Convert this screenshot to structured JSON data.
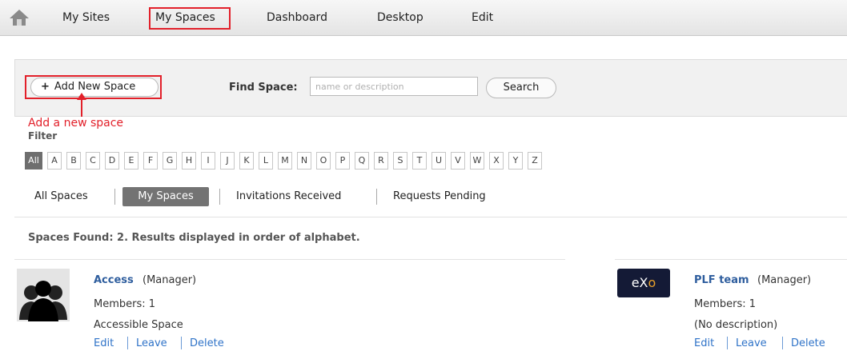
{
  "nav": {
    "items": [
      {
        "label": "My Sites"
      },
      {
        "label": "My Spaces"
      },
      {
        "label": "Dashboard"
      },
      {
        "label": "Desktop"
      },
      {
        "label": "Edit"
      }
    ]
  },
  "toolbar": {
    "add_label": "Add New Space",
    "annotation": "Add a new space",
    "find_label": "Find Space:",
    "search_placeholder": "name or description",
    "search_label": "Search"
  },
  "filter": {
    "title": "Filter",
    "letters": [
      "All",
      "A",
      "B",
      "C",
      "D",
      "E",
      "F",
      "G",
      "H",
      "I",
      "J",
      "K",
      "L",
      "M",
      "N",
      "O",
      "P",
      "Q",
      "R",
      "S",
      "T",
      "U",
      "V",
      "W",
      "X",
      "Y",
      "Z"
    ],
    "active": "All"
  },
  "tabs": {
    "all": "All Spaces",
    "mine": "My Spaces",
    "invitations": "Invitations Received",
    "pending": "Requests Pending"
  },
  "results": {
    "summary": "Spaces Found: 2. Results displayed in order of alphabet."
  },
  "spaces": [
    {
      "name": "Access",
      "role": "(Manager)",
      "members": "Members: 1",
      "description": "Accessible Space",
      "actions": {
        "edit": "Edit",
        "leave": "Leave",
        "delete": "Delete"
      }
    },
    {
      "name": "PLF team",
      "role": "(Manager)",
      "members": "Members: 1",
      "description": "(No description)",
      "logo_text": "eXo",
      "actions": {
        "edit": "Edit",
        "leave": "Leave",
        "delete": "Delete"
      }
    }
  ],
  "colors": {
    "annotation_red": "#e2202a",
    "link_blue": "#2f73c8",
    "active_tab": "#737373",
    "logo_bg": "#141a36"
  }
}
